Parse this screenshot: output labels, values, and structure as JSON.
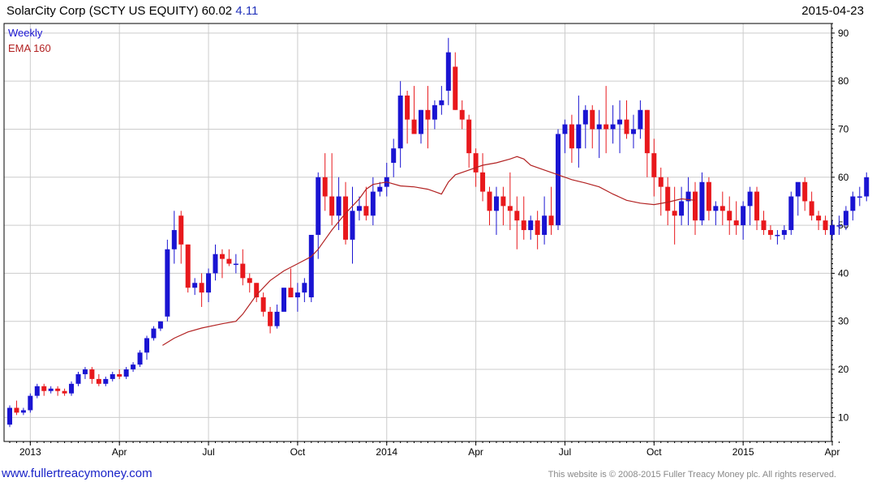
{
  "header": {
    "title": "SolarCity Corp (SCTY US EQUITY) 60.02",
    "change": "4.11",
    "date": "2015-04-23"
  },
  "footer": {
    "link_text": "www.fullertreacymoney.com",
    "copyright": "This website is © 2008-2015 Fuller Treacy Money plc. All rights reserved."
  },
  "colors": {
    "up": "#1a14d2",
    "down": "#e8181c",
    "ema": "#b22222",
    "weekly_label": "#1a14d2",
    "grid": "#cccccc"
  },
  "chart_data": {
    "type": "candlestick",
    "legend": [
      {
        "name": "Weekly",
        "color": "#1a14d2"
      },
      {
        "name": "EMA 160",
        "color": "#b22222"
      }
    ],
    "ylim": [
      5,
      92
    ],
    "yticks": [
      10,
      20,
      30,
      40,
      50,
      60,
      70,
      80,
      90
    ],
    "x_tick_labels": [
      {
        "label": "2013",
        "week": 3
      },
      {
        "label": "Apr",
        "week": 16
      },
      {
        "label": "Jul",
        "week": 29
      },
      {
        "label": "Oct",
        "week": 42
      },
      {
        "label": "2014",
        "week": 55
      },
      {
        "label": "Apr",
        "week": 68
      },
      {
        "label": "Jul",
        "week": 81
      },
      {
        "label": "Oct",
        "week": 94
      },
      {
        "label": "2015",
        "week": 107
      },
      {
        "label": "Apr",
        "week": 120
      }
    ],
    "x_count": 122,
    "candles": [
      [
        8.5,
        12.5,
        8,
        12
      ],
      [
        12,
        13.5,
        10.5,
        11
      ],
      [
        11,
        12,
        10.5,
        11.5
      ],
      [
        11.5,
        15,
        11,
        14.5
      ],
      [
        14.5,
        17,
        14,
        16.5
      ],
      [
        16.5,
        17,
        14.5,
        15.5
      ],
      [
        15.5,
        16.5,
        15,
        16
      ],
      [
        16,
        16.5,
        14.5,
        15.5
      ],
      [
        15.5,
        16,
        14.5,
        15
      ],
      [
        15,
        17.5,
        14.5,
        17
      ],
      [
        17,
        19.5,
        16.5,
        19
      ],
      [
        19,
        20.5,
        18,
        20
      ],
      [
        20,
        20.5,
        17,
        18
      ],
      [
        18,
        19,
        16.5,
        17
      ],
      [
        17,
        18.5,
        16.5,
        18
      ],
      [
        18,
        19.5,
        17.5,
        19
      ],
      [
        19,
        20,
        18,
        18.5
      ],
      [
        18.5,
        20.5,
        18,
        20
      ],
      [
        20,
        21.5,
        19.5,
        21
      ],
      [
        21,
        24,
        20.5,
        23.5
      ],
      [
        23.5,
        27,
        22,
        26.5
      ],
      [
        26.5,
        29,
        26,
        28.5
      ],
      [
        28.5,
        30,
        28,
        30
      ],
      [
        31,
        47,
        30,
        45
      ],
      [
        45,
        53,
        42,
        49
      ],
      [
        52,
        53,
        42,
        46
      ],
      [
        46,
        46,
        36,
        37
      ],
      [
        37,
        39,
        35.5,
        38
      ],
      [
        38,
        40,
        33,
        36
      ],
      [
        36,
        41,
        34,
        40
      ],
      [
        40,
        46,
        38.5,
        44
      ],
      [
        44,
        45,
        39,
        43
      ],
      [
        43,
        45,
        41.5,
        42
      ],
      [
        42,
        44,
        40,
        42
      ],
      [
        42,
        45,
        37.5,
        39
      ],
      [
        39,
        40,
        36,
        38
      ],
      [
        38,
        38,
        34,
        35
      ],
      [
        35,
        36,
        31,
        32
      ],
      [
        32,
        33,
        27.5,
        29
      ],
      [
        29,
        33.5,
        28.5,
        32
      ],
      [
        32,
        37,
        32,
        37
      ],
      [
        37,
        41,
        35,
        35
      ],
      [
        35,
        38,
        32,
        36
      ],
      [
        36,
        39,
        34,
        38
      ],
      [
        35,
        48,
        34,
        48
      ],
      [
        48,
        61,
        43,
        60
      ],
      [
        60,
        65,
        53,
        56
      ],
      [
        56,
        65,
        50,
        52
      ],
      [
        52,
        60,
        49,
        56
      ],
      [
        56,
        59,
        46,
        47
      ],
      [
        47,
        58,
        42,
        53
      ],
      [
        53,
        56,
        51,
        54
      ],
      [
        54,
        58,
        51,
        52
      ],
      [
        52,
        60,
        50,
        57
      ],
      [
        57,
        59,
        56,
        58
      ],
      [
        58,
        63,
        56,
        60
      ],
      [
        63,
        68,
        60,
        66
      ],
      [
        66,
        80,
        62,
        77
      ],
      [
        77,
        78,
        67,
        72
      ],
      [
        72,
        79,
        70,
        69
      ],
      [
        69,
        74,
        67,
        74
      ],
      [
        74,
        79,
        66,
        72
      ],
      [
        72,
        76,
        70,
        75
      ],
      [
        75,
        79,
        73,
        76
      ],
      [
        78,
        89,
        75,
        86
      ],
      [
        83,
        86,
        74,
        74
      ],
      [
        74,
        76,
        70,
        72
      ],
      [
        72,
        73,
        62,
        65
      ],
      [
        65,
        66,
        58,
        61
      ],
      [
        61,
        65,
        55,
        57
      ],
      [
        57,
        58,
        50,
        53
      ],
      [
        53,
        58,
        48,
        56
      ],
      [
        56,
        58,
        50,
        54
      ],
      [
        54,
        61,
        49,
        53
      ],
      [
        53,
        56,
        45,
        51
      ],
      [
        51,
        56,
        47,
        49
      ],
      [
        49,
        52,
        47,
        51
      ],
      [
        51,
        53,
        45,
        48
      ],
      [
        48,
        56,
        46,
        52
      ],
      [
        52,
        58,
        48,
        50
      ],
      [
        50,
        70,
        49,
        69
      ],
      [
        69,
        72,
        65,
        71
      ],
      [
        71,
        73,
        63,
        66
      ],
      [
        66,
        77,
        62,
        71
      ],
      [
        71,
        75,
        66,
        74
      ],
      [
        74,
        75,
        66,
        70
      ],
      [
        70,
        74,
        64,
        71
      ],
      [
        71,
        79,
        65,
        70
      ],
      [
        70,
        75,
        67,
        71
      ],
      [
        71,
        76,
        65,
        72
      ],
      [
        72,
        76,
        68,
        69
      ],
      [
        69,
        73,
        66,
        70
      ],
      [
        70,
        76,
        68,
        74
      ],
      [
        74,
        74,
        60,
        65
      ],
      [
        65,
        68,
        56,
        60
      ],
      [
        60,
        62,
        52,
        58
      ],
      [
        58,
        60,
        50,
        53
      ],
      [
        53,
        58,
        46,
        52
      ],
      [
        52,
        58,
        50,
        55
      ],
      [
        55,
        60,
        50,
        57
      ],
      [
        57,
        59,
        48,
        51
      ],
      [
        51,
        61,
        50,
        59
      ],
      [
        59,
        60,
        51,
        53
      ],
      [
        53,
        55,
        50,
        54
      ],
      [
        54,
        57,
        50,
        53
      ],
      [
        53,
        56,
        48,
        51
      ],
      [
        51,
        55,
        48,
        50
      ],
      [
        50,
        55,
        47,
        54
      ],
      [
        54,
        58,
        50,
        57
      ],
      [
        57,
        58,
        49,
        51
      ],
      [
        51,
        53,
        48,
        49
      ],
      [
        49,
        50,
        47,
        48
      ],
      [
        48,
        49,
        46,
        48
      ],
      [
        48,
        50,
        47,
        49
      ],
      [
        49,
        57,
        48,
        56
      ],
      [
        56,
        58,
        52,
        59
      ],
      [
        59,
        60,
        53,
        55
      ],
      [
        55,
        57,
        51,
        52
      ],
      [
        52,
        53,
        49,
        51
      ],
      [
        51,
        52,
        48,
        49
      ],
      [
        48,
        51,
        47,
        50
      ],
      [
        50,
        52,
        48,
        50
      ],
      [
        50,
        54,
        49,
        53
      ],
      [
        53,
        57,
        51,
        56
      ],
      [
        56,
        58,
        54,
        56
      ],
      [
        56,
        61,
        55,
        60
      ]
    ],
    "ema": [
      {
        "week": 22.3,
        "value": 25
      },
      {
        "week": 24,
        "value": 26.5
      },
      {
        "week": 26,
        "value": 27.8
      },
      {
        "week": 28,
        "value": 28.6
      },
      {
        "week": 31,
        "value": 29.5
      },
      {
        "week": 33,
        "value": 30
      },
      {
        "week": 34,
        "value": 31.5
      },
      {
        "week": 36,
        "value": 35.5
      },
      {
        "week": 38,
        "value": 38.5
      },
      {
        "week": 40,
        "value": 40.5
      },
      {
        "week": 42,
        "value": 42
      },
      {
        "week": 44,
        "value": 43.5
      },
      {
        "week": 45,
        "value": 45
      },
      {
        "week": 47,
        "value": 49
      },
      {
        "week": 49,
        "value": 52.5
      },
      {
        "week": 51,
        "value": 55.5
      },
      {
        "week": 52,
        "value": 57.5
      },
      {
        "week": 53,
        "value": 58.5
      },
      {
        "week": 55,
        "value": 59
      },
      {
        "week": 57,
        "value": 58.2
      },
      {
        "week": 59,
        "value": 58
      },
      {
        "week": 61,
        "value": 57.5
      },
      {
        "week": 62,
        "value": 57
      },
      {
        "week": 63,
        "value": 56.5
      },
      {
        "week": 64,
        "value": 59
      },
      {
        "week": 65,
        "value": 60.5
      },
      {
        "week": 67,
        "value": 61.5
      },
      {
        "week": 69,
        "value": 62.5
      },
      {
        "week": 71,
        "value": 63
      },
      {
        "week": 73,
        "value": 63.8
      },
      {
        "week": 74,
        "value": 64.3
      },
      {
        "week": 75,
        "value": 63.8
      },
      {
        "week": 76,
        "value": 62.5
      },
      {
        "week": 78,
        "value": 61.5
      },
      {
        "week": 80,
        "value": 60.5
      },
      {
        "week": 82,
        "value": 59.5
      },
      {
        "week": 84,
        "value": 58.8
      },
      {
        "week": 86,
        "value": 58
      },
      {
        "week": 88,
        "value": 56.5
      },
      {
        "week": 90,
        "value": 55.2
      },
      {
        "week": 92,
        "value": 54.6
      },
      {
        "week": 94,
        "value": 54.3
      },
      {
        "week": 96,
        "value": 54.8
      },
      {
        "week": 98,
        "value": 55.5
      },
      {
        "week": 100,
        "value": 55.2
      }
    ]
  }
}
